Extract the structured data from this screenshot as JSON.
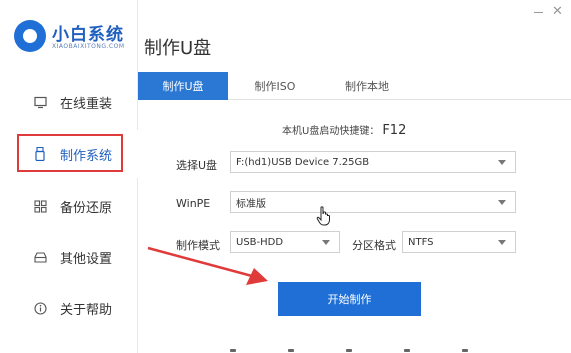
{
  "app": {
    "logo_title": "小白系统",
    "logo_subtitle": "XIAOBAIXITONG.COM"
  },
  "window": {
    "minimize_label": "—",
    "close_label": "✕"
  },
  "sidebar": {
    "items": [
      {
        "label": "在线重装",
        "icon": "monitor-icon"
      },
      {
        "label": "制作系统",
        "icon": "usb-drive-icon"
      },
      {
        "label": "备份还原",
        "icon": "backup-grid-icon"
      },
      {
        "label": "其他设置",
        "icon": "settings-tray-icon"
      },
      {
        "label": "关于帮助",
        "icon": "info-icon"
      }
    ],
    "active_index": 1
  },
  "page": {
    "title": "制作U盘"
  },
  "tabs": [
    {
      "label": "制作U盘",
      "active": true
    },
    {
      "label": "制作ISO",
      "active": false
    },
    {
      "label": "制作本地",
      "active": false
    }
  ],
  "form": {
    "hotkey_label": "本机U盘启动快捷键：",
    "hotkey_value": "F12",
    "select_usb_label": "选择U盘",
    "select_usb_value": "F:(hd1)USB Device 7.25GB",
    "winpe_label": "WinPE",
    "winpe_value": "标准版",
    "mode_label": "制作模式",
    "mode_value": "USB-HDD",
    "partition_label": "分区格式",
    "partition_value": "NTFS",
    "start_button": "开始制作"
  },
  "colors": {
    "accent": "#1f6fd6",
    "annotation_red": "#e03b3b"
  }
}
